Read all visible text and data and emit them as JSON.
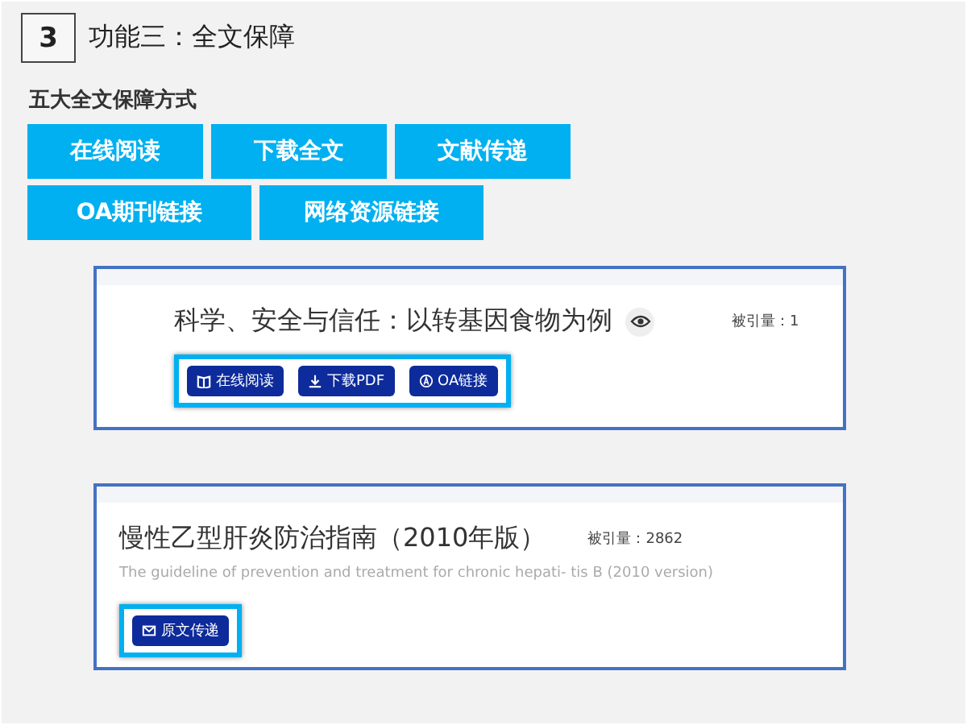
{
  "header": {
    "number": "3",
    "title": "功能三：全文保障"
  },
  "section_title": "五大全文保障方式",
  "methods": [
    "在线阅读",
    "下载全文",
    "文献传递",
    "OA期刊链接",
    "网络资源链接"
  ],
  "articles": [
    {
      "kind": "indented",
      "title": "科学、安全与信任：以转基因食物为例",
      "preview": true,
      "citation": "被引量：1",
      "actions": [
        {
          "kind": "book",
          "label": "在线阅读"
        },
        {
          "kind": "download",
          "label": "下载PDF"
        },
        {
          "kind": "oa",
          "label": "OA链接"
        }
      ]
    },
    {
      "kind": "standard",
      "title": "慢性乙型肝炎防治指南（2010年版）",
      "subtitle": "The guideline of prevention and treatment for chronic hepati- tis B  (2010 version)",
      "citation": "被引量：2862",
      "actions": [
        {
          "kind": "mail",
          "label": "原文传递"
        }
      ]
    }
  ]
}
